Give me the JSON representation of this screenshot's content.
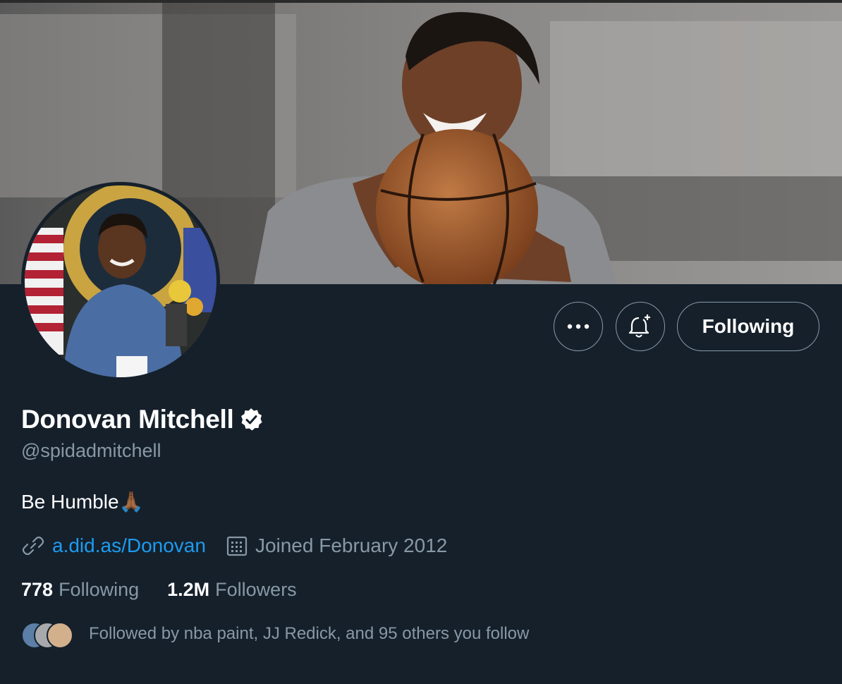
{
  "profile": {
    "name": "Donovan Mitchell",
    "handle": "@spidadmitchell",
    "bio": "Be Humble",
    "bio_emoji": "🙏🏾",
    "link": "a.did.as/Donovan",
    "joined": "Joined February 2012",
    "following_count": "778",
    "following_label": "Following",
    "followers_count": "1.2M",
    "followers_label": "Followers",
    "followed_by": "Followed by nba paint, JJ Redick, and 95 others you follow"
  },
  "actions": {
    "more_icon": "more-icon",
    "bell_icon": "notification-bell-plus-icon",
    "following_button": "Following"
  },
  "icons": {
    "verified": "verified-badge-icon",
    "link": "link-icon",
    "calendar": "calendar-icon"
  },
  "colors": {
    "background": "#15202b",
    "accent": "#1d9bf0",
    "muted": "#8899a6"
  }
}
